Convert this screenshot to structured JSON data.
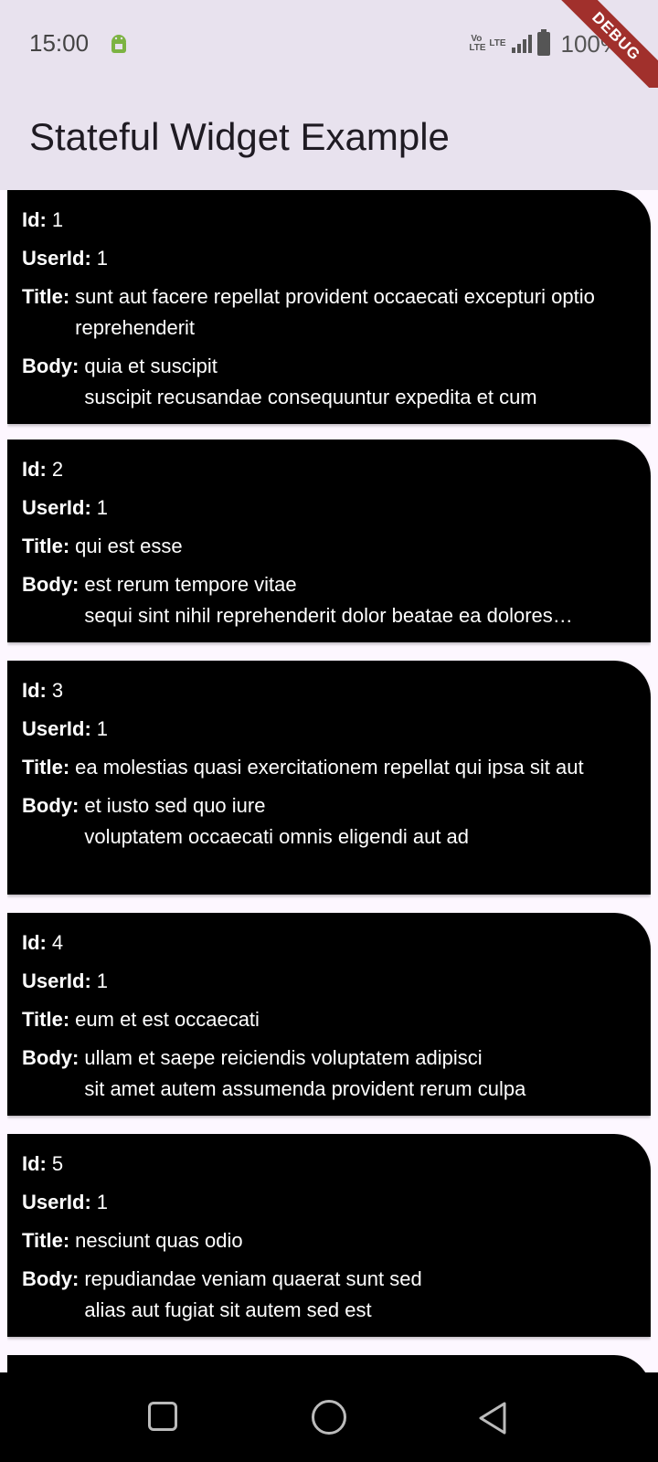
{
  "status_bar": {
    "time": "15:00",
    "volte_label": "Vo LTE",
    "lte_label": "LTE",
    "battery": "100%",
    "debug_banner": "DEBUG"
  },
  "app_bar": {
    "title": "Stateful Widget Example"
  },
  "labels": {
    "id": "Id:",
    "user_id": "UserId:",
    "title": "Title:",
    "body": "Body:"
  },
  "posts": [
    {
      "id": "1",
      "user_id": "1",
      "title": "sunt aut facere repellat provident occaecati excepturi optio reprehenderit",
      "body_line1": "quia et suscipit",
      "body_line2": "suscipit recusandae consequuntur expedita et cum"
    },
    {
      "id": "2",
      "user_id": "1",
      "title": "qui est esse",
      "body_line1": "est rerum tempore vitae",
      "body_line2": "sequi sint nihil reprehenderit dolor beatae ea dolores…"
    },
    {
      "id": "3",
      "user_id": "1",
      "title": "ea molestias quasi exercitationem repellat qui ipsa sit aut",
      "body_line1": "et iusto sed quo iure",
      "body_line2": "voluptatem occaecati omnis eligendi aut ad"
    },
    {
      "id": "4",
      "user_id": "1",
      "title": "eum et est occaecati",
      "body_line1": "ullam et saepe reiciendis voluptatem adipisci",
      "body_line2": "sit amet autem assumenda provident rerum culpa"
    },
    {
      "id": "5",
      "user_id": "1",
      "title": "nesciunt quas odio",
      "body_line1": "repudiandae veniam quaerat sunt sed",
      "body_line2": "alias aut fugiat sit autem sed est"
    }
  ]
}
